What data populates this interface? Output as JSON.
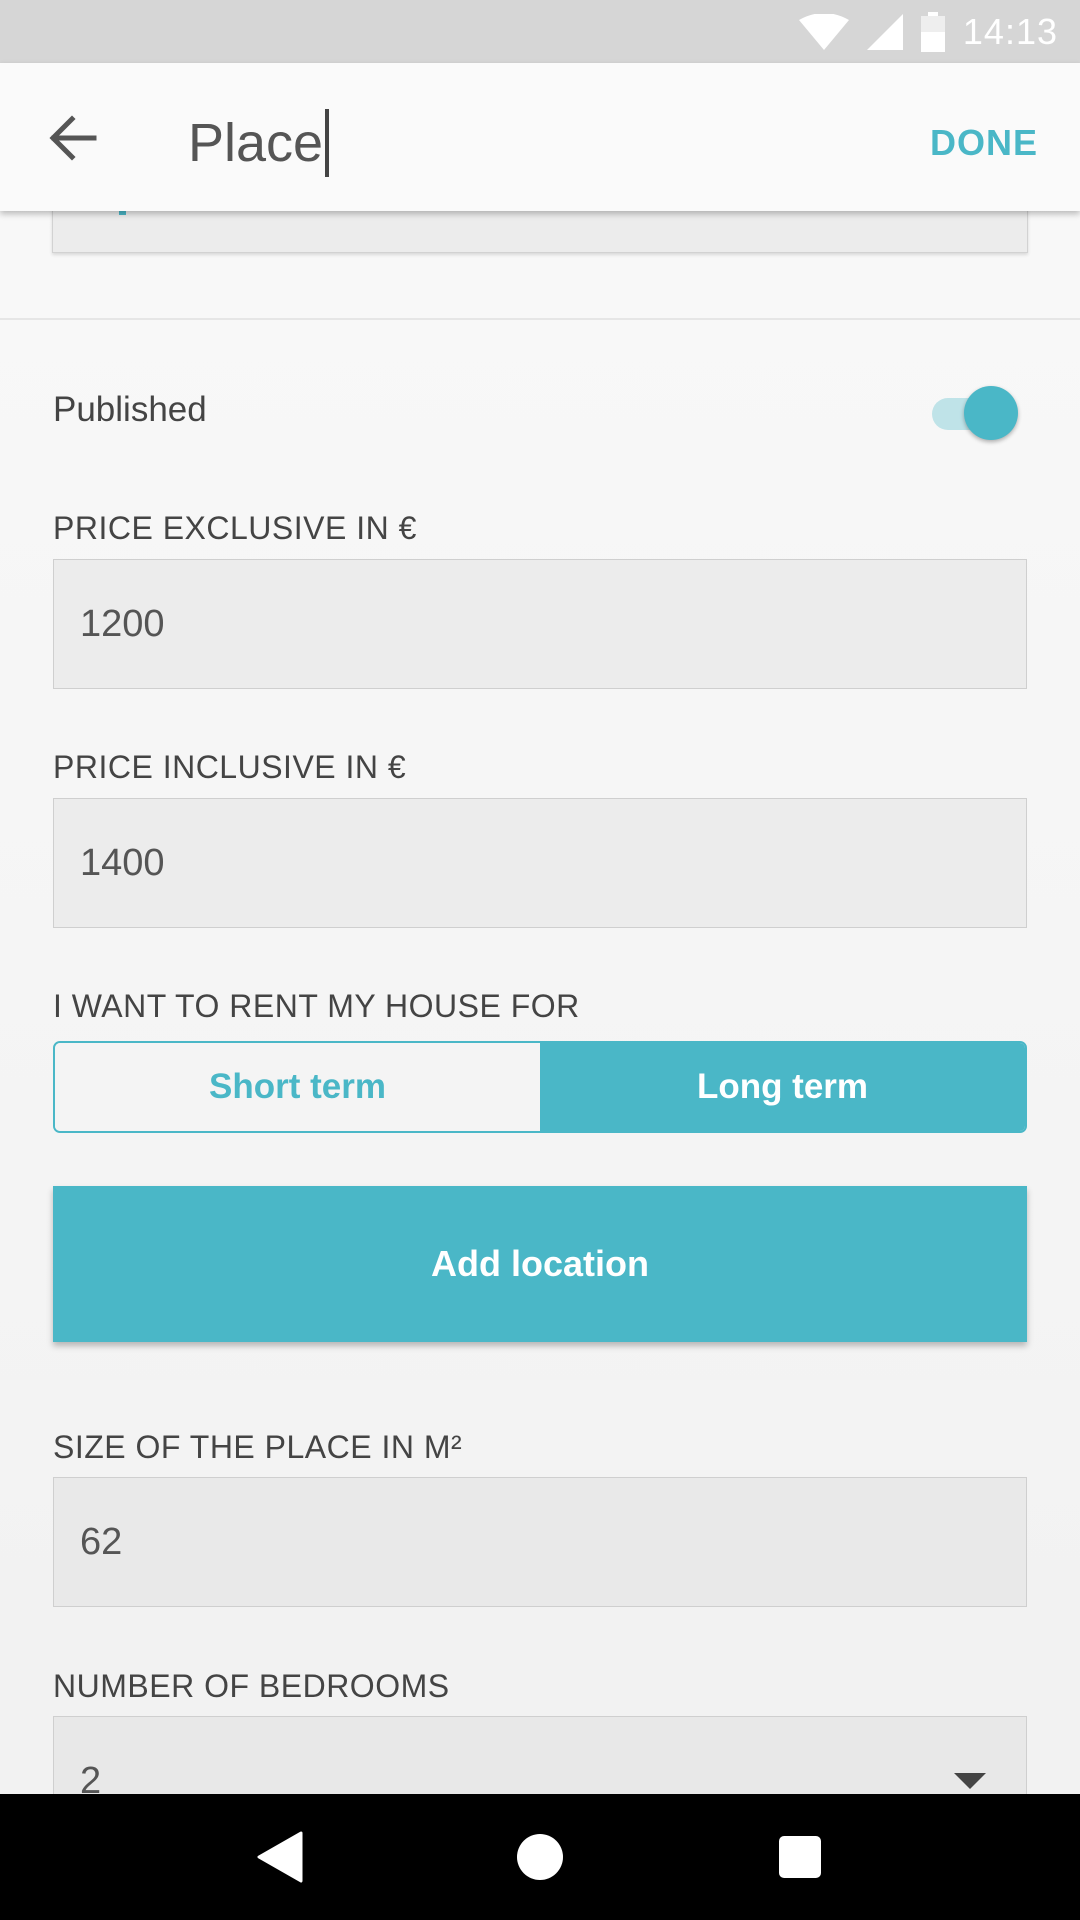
{
  "status_bar": {
    "time": "14:13"
  },
  "app_bar": {
    "title_value": "Place",
    "done_label": "DONE"
  },
  "published": {
    "label": "Published",
    "enabled": true
  },
  "price_exclusive": {
    "label": "PRICE EXCLUSIVE IN €",
    "value": "1200"
  },
  "price_inclusive": {
    "label": "PRICE INCLUSIVE IN €",
    "value": "1400"
  },
  "rent_term": {
    "label": "I WANT TO RENT MY HOUSE FOR",
    "options": [
      "Short term",
      "Long term"
    ],
    "selected": "Long term"
  },
  "add_location": {
    "label": "Add location"
  },
  "size": {
    "label": "SIZE OF THE PLACE IN M²",
    "value": "62"
  },
  "bedrooms": {
    "label": "NUMBER OF BEDROOMS",
    "value": "2"
  },
  "colors": {
    "accent": "#4ab7c7",
    "status_bar": "#d6d6d6",
    "nav_bar": "#000000"
  }
}
